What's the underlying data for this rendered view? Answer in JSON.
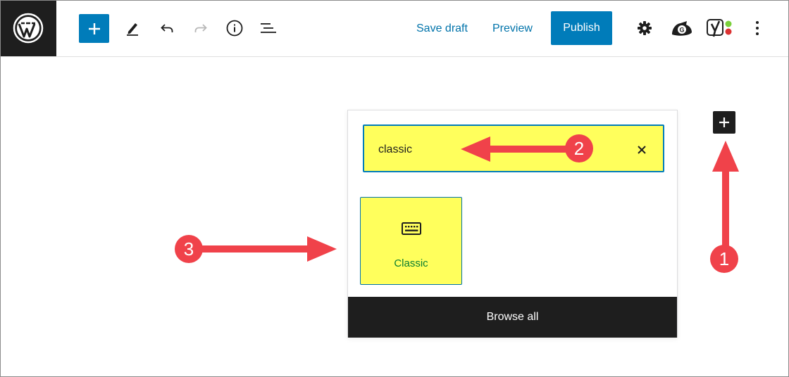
{
  "toolbar": {
    "save_draft_label": "Save draft",
    "preview_label": "Preview",
    "publish_label": "Publish",
    "icons": {
      "logo": "wordpress-logo-icon",
      "inserter": "plus-icon",
      "tools": "pencil-icon",
      "undo": "undo-icon",
      "redo": "redo-icon",
      "details": "info-icon",
      "outline": "list-view-icon",
      "settings": "gear-icon",
      "plugin": "grammarly-icon",
      "seo": "yoast-icon",
      "more": "more-vertical-icon"
    }
  },
  "inserter": {
    "search_value": "classic",
    "results": [
      {
        "label": "Classic",
        "icon": "keyboard-icon"
      }
    ],
    "browse_all_label": "Browse all"
  },
  "annotations": {
    "badges": [
      "1",
      "2",
      "3"
    ],
    "highlight_color": "#ffff5c",
    "arrow_color": "#f0424a"
  },
  "colors": {
    "accent": "#007cba",
    "dark": "#1e1e1e",
    "link": "#0073aa"
  }
}
